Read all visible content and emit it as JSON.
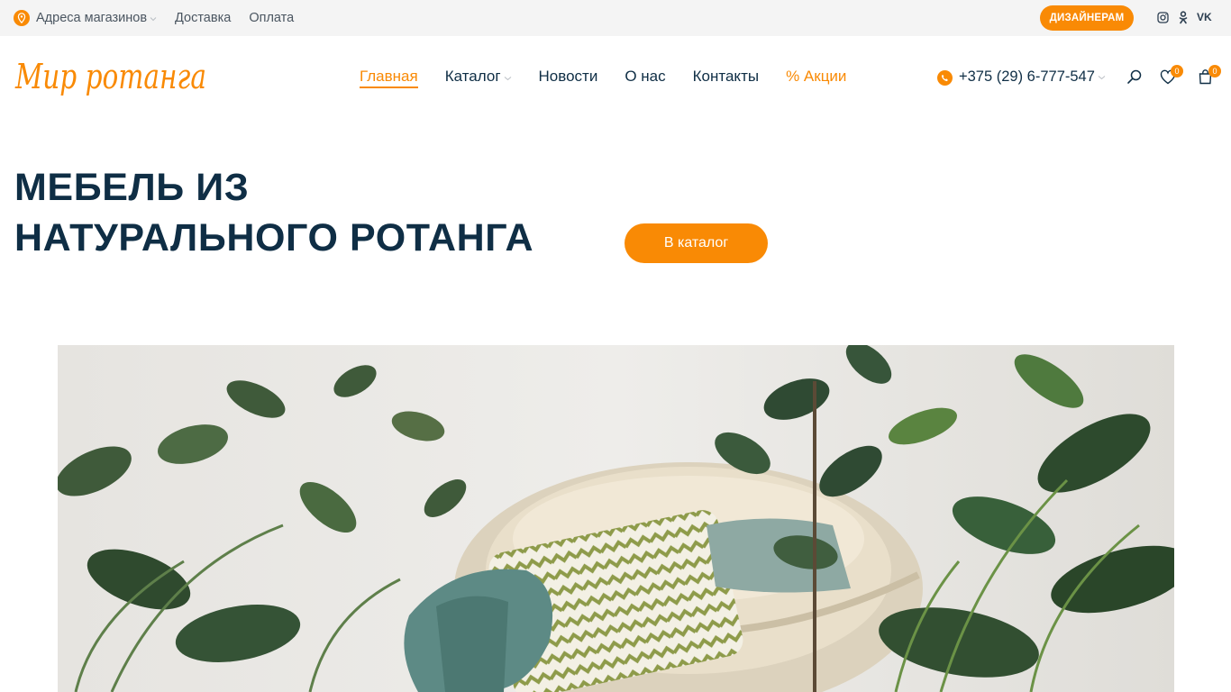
{
  "topbar": {
    "stores_label": "Адреса магазинов",
    "delivery_label": "Доставка",
    "payment_label": "Оплата",
    "designers_label": "ДИЗАЙНЕРАМ",
    "vk_label": "VK"
  },
  "header": {
    "logo_text": "Мир ротанга",
    "nav": {
      "home": "Главная",
      "catalog": "Каталог",
      "news": "Новости",
      "about": "О нас",
      "contacts": "Контакты",
      "sale": "% Акции"
    },
    "phone": "+375 (29) 6-777-547",
    "wishlist_count": "0",
    "cart_count": "0"
  },
  "hero": {
    "title_line1": "МЕБЕЛЬ ИЗ",
    "title_line2": "НАТУРАЛЬНОГО РОТАНГА",
    "cta_label": "В каталог"
  },
  "colors": {
    "accent": "#f98a05",
    "text_dark": "#0f2e45",
    "topbar_bg": "#f4f4f4"
  }
}
